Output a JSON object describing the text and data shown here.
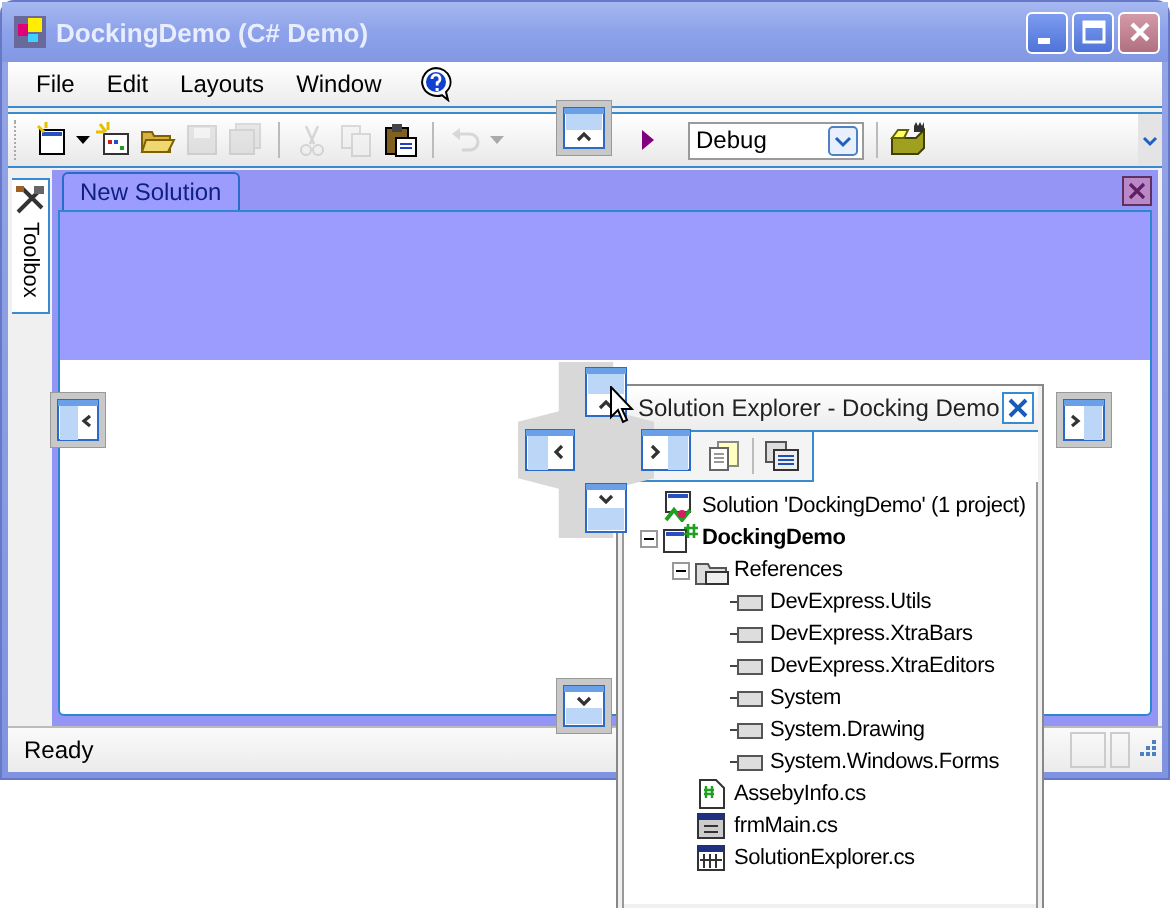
{
  "window": {
    "title": "DockingDemo (C# Demo)"
  },
  "menu": [
    {
      "label": "File"
    },
    {
      "label": "Edit"
    },
    {
      "label": "Layouts"
    },
    {
      "label": "Window"
    }
  ],
  "toolbar": [
    {
      "kind": "new-project",
      "disabled": false
    },
    {
      "kind": "dropdown",
      "disabled": false
    },
    {
      "kind": "add-item",
      "disabled": false
    },
    {
      "kind": "open",
      "disabled": false
    },
    {
      "kind": "save",
      "disabled": true
    },
    {
      "kind": "save-all",
      "disabled": true
    },
    {
      "kind": "separator"
    },
    {
      "kind": "cut",
      "disabled": true
    },
    {
      "kind": "copy",
      "disabled": true
    },
    {
      "kind": "paste",
      "disabled": false
    },
    {
      "kind": "separator"
    },
    {
      "kind": "undo",
      "disabled": true
    },
    {
      "kind": "dropdown",
      "disabled": true
    },
    {
      "kind": "run",
      "disabled": false
    }
  ],
  "configuration": {
    "value": "Debug"
  },
  "toolbox": {
    "label": "Toolbox"
  },
  "document_tabs": [
    {
      "label": "New Solution",
      "selected": true
    }
  ],
  "status_bar": {
    "text": "Ready"
  },
  "solution_explorer": {
    "title": "Solution Explorer - Docking Demo",
    "tree": [
      {
        "label": "Solution 'DockingDemo' (1 project)",
        "kind": "solution",
        "children": [
          {
            "label": "DockingDemo",
            "kind": "project",
            "expanded": true,
            "children": [
              {
                "label": "References",
                "kind": "folder",
                "expanded": true,
                "children": [
                  {
                    "label": "DevExpress.Utils",
                    "kind": "reference"
                  },
                  {
                    "label": "DevExpress.XtraBars",
                    "kind": "reference"
                  },
                  {
                    "label": "DevExpress.XtraEditors",
                    "kind": "reference"
                  },
                  {
                    "label": "System",
                    "kind": "reference"
                  },
                  {
                    "label": "System.Drawing",
                    "kind": "reference"
                  },
                  {
                    "label": "System.Windows.Forms",
                    "kind": "reference"
                  }
                ]
              },
              {
                "label": "AssebyInfo.cs",
                "kind": "code-file"
              },
              {
                "label": "frmMain.cs",
                "kind": "form-file"
              },
              {
                "label": "SolutionExplorer.cs",
                "kind": "control-file"
              }
            ]
          }
        ]
      }
    ]
  }
}
